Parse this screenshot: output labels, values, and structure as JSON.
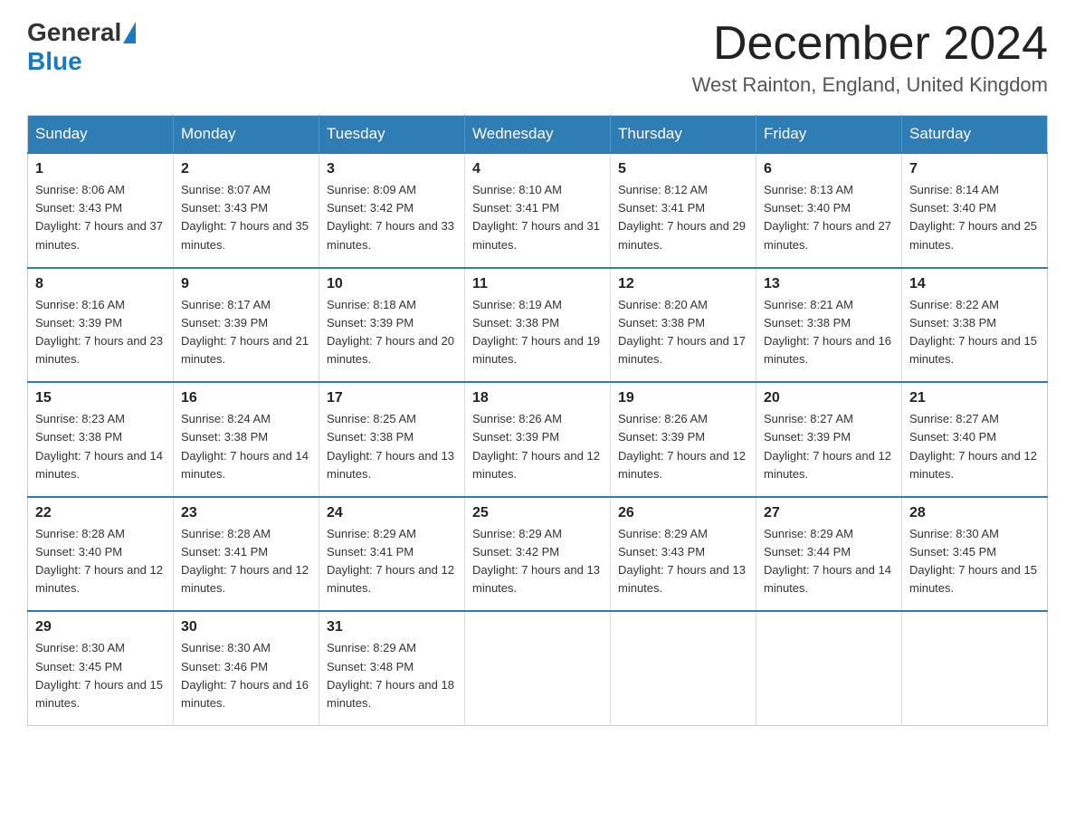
{
  "logo": {
    "general": "General",
    "blue": "Blue"
  },
  "header": {
    "month": "December 2024",
    "location": "West Rainton, England, United Kingdom"
  },
  "days_of_week": [
    "Sunday",
    "Monday",
    "Tuesday",
    "Wednesday",
    "Thursday",
    "Friday",
    "Saturday"
  ],
  "weeks": [
    [
      {
        "day": "1",
        "sunrise": "8:06 AM",
        "sunset": "3:43 PM",
        "daylight": "7 hours and 37 minutes."
      },
      {
        "day": "2",
        "sunrise": "8:07 AM",
        "sunset": "3:43 PM",
        "daylight": "7 hours and 35 minutes."
      },
      {
        "day": "3",
        "sunrise": "8:09 AM",
        "sunset": "3:42 PM",
        "daylight": "7 hours and 33 minutes."
      },
      {
        "day": "4",
        "sunrise": "8:10 AM",
        "sunset": "3:41 PM",
        "daylight": "7 hours and 31 minutes."
      },
      {
        "day": "5",
        "sunrise": "8:12 AM",
        "sunset": "3:41 PM",
        "daylight": "7 hours and 29 minutes."
      },
      {
        "day": "6",
        "sunrise": "8:13 AM",
        "sunset": "3:40 PM",
        "daylight": "7 hours and 27 minutes."
      },
      {
        "day": "7",
        "sunrise": "8:14 AM",
        "sunset": "3:40 PM",
        "daylight": "7 hours and 25 minutes."
      }
    ],
    [
      {
        "day": "8",
        "sunrise": "8:16 AM",
        "sunset": "3:39 PM",
        "daylight": "7 hours and 23 minutes."
      },
      {
        "day": "9",
        "sunrise": "8:17 AM",
        "sunset": "3:39 PM",
        "daylight": "7 hours and 21 minutes."
      },
      {
        "day": "10",
        "sunrise": "8:18 AM",
        "sunset": "3:39 PM",
        "daylight": "7 hours and 20 minutes."
      },
      {
        "day": "11",
        "sunrise": "8:19 AM",
        "sunset": "3:38 PM",
        "daylight": "7 hours and 19 minutes."
      },
      {
        "day": "12",
        "sunrise": "8:20 AM",
        "sunset": "3:38 PM",
        "daylight": "7 hours and 17 minutes."
      },
      {
        "day": "13",
        "sunrise": "8:21 AM",
        "sunset": "3:38 PM",
        "daylight": "7 hours and 16 minutes."
      },
      {
        "day": "14",
        "sunrise": "8:22 AM",
        "sunset": "3:38 PM",
        "daylight": "7 hours and 15 minutes."
      }
    ],
    [
      {
        "day": "15",
        "sunrise": "8:23 AM",
        "sunset": "3:38 PM",
        "daylight": "7 hours and 14 minutes."
      },
      {
        "day": "16",
        "sunrise": "8:24 AM",
        "sunset": "3:38 PM",
        "daylight": "7 hours and 14 minutes."
      },
      {
        "day": "17",
        "sunrise": "8:25 AM",
        "sunset": "3:38 PM",
        "daylight": "7 hours and 13 minutes."
      },
      {
        "day": "18",
        "sunrise": "8:26 AM",
        "sunset": "3:39 PM",
        "daylight": "7 hours and 12 minutes."
      },
      {
        "day": "19",
        "sunrise": "8:26 AM",
        "sunset": "3:39 PM",
        "daylight": "7 hours and 12 minutes."
      },
      {
        "day": "20",
        "sunrise": "8:27 AM",
        "sunset": "3:39 PM",
        "daylight": "7 hours and 12 minutes."
      },
      {
        "day": "21",
        "sunrise": "8:27 AM",
        "sunset": "3:40 PM",
        "daylight": "7 hours and 12 minutes."
      }
    ],
    [
      {
        "day": "22",
        "sunrise": "8:28 AM",
        "sunset": "3:40 PM",
        "daylight": "7 hours and 12 minutes."
      },
      {
        "day": "23",
        "sunrise": "8:28 AM",
        "sunset": "3:41 PM",
        "daylight": "7 hours and 12 minutes."
      },
      {
        "day": "24",
        "sunrise": "8:29 AM",
        "sunset": "3:41 PM",
        "daylight": "7 hours and 12 minutes."
      },
      {
        "day": "25",
        "sunrise": "8:29 AM",
        "sunset": "3:42 PM",
        "daylight": "7 hours and 13 minutes."
      },
      {
        "day": "26",
        "sunrise": "8:29 AM",
        "sunset": "3:43 PM",
        "daylight": "7 hours and 13 minutes."
      },
      {
        "day": "27",
        "sunrise": "8:29 AM",
        "sunset": "3:44 PM",
        "daylight": "7 hours and 14 minutes."
      },
      {
        "day": "28",
        "sunrise": "8:30 AM",
        "sunset": "3:45 PM",
        "daylight": "7 hours and 15 minutes."
      }
    ],
    [
      {
        "day": "29",
        "sunrise": "8:30 AM",
        "sunset": "3:45 PM",
        "daylight": "7 hours and 15 minutes."
      },
      {
        "day": "30",
        "sunrise": "8:30 AM",
        "sunset": "3:46 PM",
        "daylight": "7 hours and 16 minutes."
      },
      {
        "day": "31",
        "sunrise": "8:29 AM",
        "sunset": "3:48 PM",
        "daylight": "7 hours and 18 minutes."
      },
      null,
      null,
      null,
      null
    ]
  ]
}
